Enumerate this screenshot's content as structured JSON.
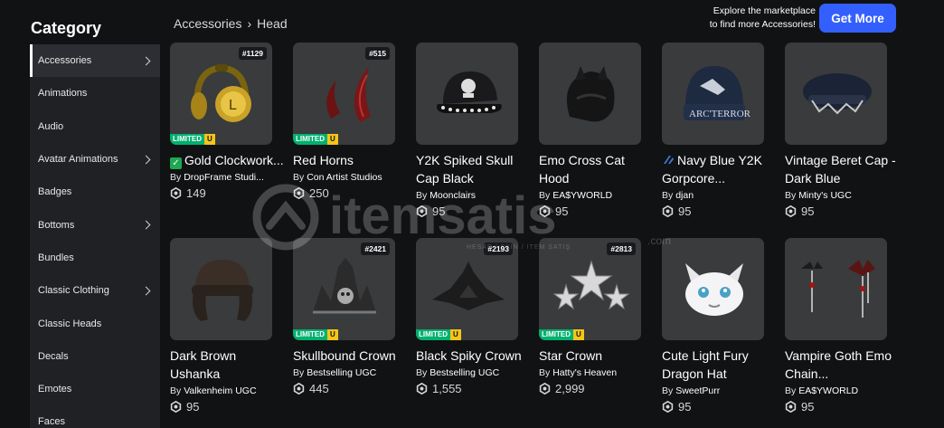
{
  "sidebar": {
    "title": "Category",
    "items": [
      {
        "label": "Accessories",
        "chevron": true,
        "active": true
      },
      {
        "label": "Animations",
        "chevron": false
      },
      {
        "label": "Audio",
        "chevron": false
      },
      {
        "label": "Avatar Animations",
        "chevron": true
      },
      {
        "label": "Badges",
        "chevron": false
      },
      {
        "label": "Bottoms",
        "chevron": true
      },
      {
        "label": "Bundles",
        "chevron": false
      },
      {
        "label": "Classic Clothing",
        "chevron": true
      },
      {
        "label": "Classic Heads",
        "chevron": false
      },
      {
        "label": "Decals",
        "chevron": false
      },
      {
        "label": "Emotes",
        "chevron": false
      },
      {
        "label": "Faces",
        "chevron": false
      }
    ]
  },
  "breadcrumb": {
    "root": "Accessories",
    "separator": "›",
    "current": "Head"
  },
  "promo": {
    "line1": "Explore the marketplace",
    "line2": "to find more Accessories!",
    "button": "Get More"
  },
  "limited_badge": {
    "text": "LIMITED",
    "u": "U"
  },
  "by_label": "By",
  "watermark": {
    "brand": "itemsatis",
    "tagline": "HESAP / SKIN / ITEM SATIŞ",
    "tld": ".com"
  },
  "items": [
    {
      "name": "Gold Clockwork...",
      "creator": "DropFrame Studi...",
      "price": "149",
      "serial": "#1129",
      "limited": true,
      "verified_check": true,
      "icon": "gold-headphones"
    },
    {
      "name": "Red Horns",
      "creator": "Con Artist Studios",
      "price": "250",
      "serial": "#515",
      "limited": true,
      "icon": "red-horns"
    },
    {
      "name": "Y2K Spiked Skull Cap Black",
      "creator": "Moonclairs",
      "price": "95",
      "icon": "spiked-skull-cap"
    },
    {
      "name": "Emo Cross Cat Hood",
      "creator": "EA$YWORLD",
      "price": "95",
      "icon": "emo-hood"
    },
    {
      "name": "Navy Blue Y2K Gorpcore...",
      "creator": "djan",
      "price": "95",
      "sparkle": true,
      "icon": "navy-beanie"
    },
    {
      "name": "Vintage Beret Cap - Dark Blue",
      "creator": "Minty's UGC",
      "price": "95",
      "icon": "beret-cap"
    },
    {
      "name": "Dark Brown Ushanka",
      "creator": "Valkenheim UGC",
      "price": "95",
      "icon": "ushanka"
    },
    {
      "name": "Skullbound Crown",
      "creator": "Bestselling UGC",
      "price": "445",
      "serial": "#2421",
      "limited": true,
      "icon": "skull-crown"
    },
    {
      "name": "Black Spiky Crown",
      "creator": "Bestselling UGC",
      "price": "1,555",
      "serial": "#2193",
      "limited": true,
      "icon": "spiky-crown"
    },
    {
      "name": "Star Crown",
      "creator": "Hatty's Heaven",
      "price": "2,999",
      "serial": "#2813",
      "limited": true,
      "icon": "star-crown"
    },
    {
      "name": "Cute Light Fury Dragon Hat",
      "creator": "SweetPurr",
      "price": "95",
      "icon": "dragon-hat"
    },
    {
      "name": "Vampire Goth Emo Chain...",
      "creator": "EA$YWORLD",
      "price": "95",
      "icon": "bat-chains"
    }
  ]
}
